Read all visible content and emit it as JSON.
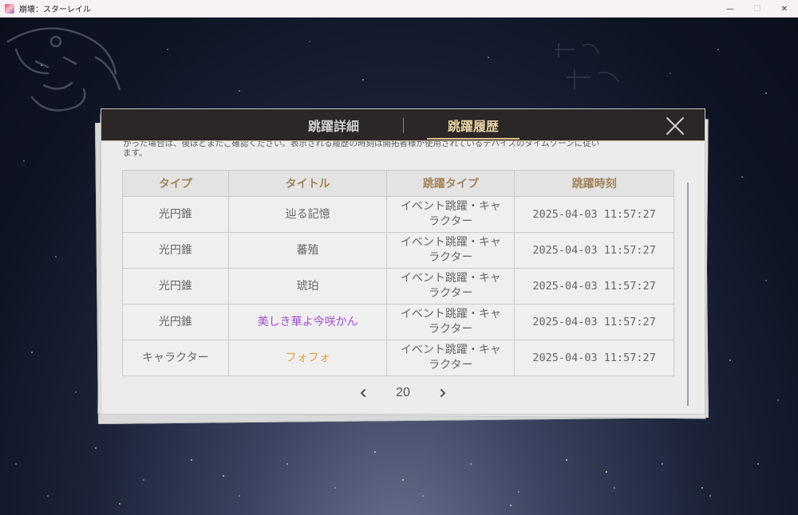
{
  "window": {
    "title": "崩壊：スターレイル",
    "minimize": "—",
    "maximize": "☐",
    "close": "✕"
  },
  "tabs": [
    {
      "label": "跳躍詳細",
      "active": false
    },
    {
      "label": "跳躍履歴",
      "active": true
    }
  ],
  "notice": {
    "line1": "かった場合は、後ほどまたご確認ください。表示される履歴の時刻は開拓者様が使用されているデバイスのタイムゾーンに従い",
    "line2": "ます。"
  },
  "table": {
    "headers": {
      "type": "タイプ",
      "title": "タイトル",
      "warp_type": "跳躍タイプ",
      "time": "跳躍時刻"
    },
    "rows": [
      {
        "type": "光円錐",
        "title": "辿る記憶",
        "title_color": "#666666",
        "warp_type_line1": "イベント跳躍・キャ",
        "warp_type_line2": "ラクター",
        "time": "2025-04-03 11:57:27"
      },
      {
        "type": "光円錐",
        "title": "蕃殖",
        "title_color": "#666666",
        "warp_type_line1": "イベント跳躍・キャ",
        "warp_type_line2": "ラクター",
        "time": "2025-04-03 11:57:27"
      },
      {
        "type": "光円錐",
        "title": "琥珀",
        "title_color": "#666666",
        "warp_type_line1": "イベント跳躍・キャ",
        "warp_type_line2": "ラクター",
        "time": "2025-04-03 11:57:27"
      },
      {
        "type": "光円錐",
        "title": "美しき華よ今咲かん",
        "title_color": "#a24fd0",
        "warp_type_line1": "イベント跳躍・キャ",
        "warp_type_line2": "ラクター",
        "time": "2025-04-03 11:57:27"
      },
      {
        "type": "キャラクター",
        "title": "フォフォ",
        "title_color": "#e0a13e",
        "warp_type_line1": "イベント跳躍・キャ",
        "warp_type_line2": "ラクター",
        "time": "2025-04-03 11:57:27"
      }
    ]
  },
  "pagination": {
    "page": "20"
  },
  "colors": {
    "accent_gold": "#d9c08a",
    "rarity_4_purple": "#a24fd0",
    "rarity_5_gold": "#e0a13e"
  }
}
